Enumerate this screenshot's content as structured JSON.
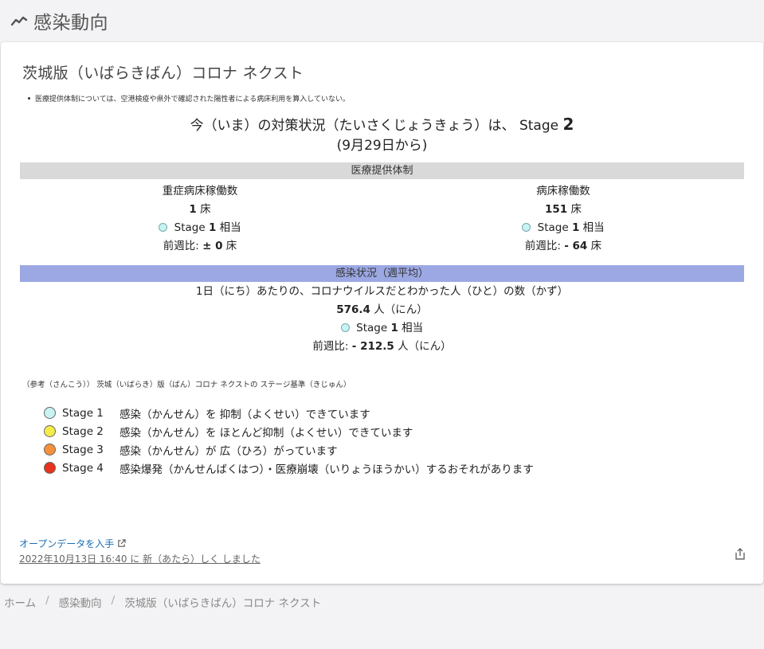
{
  "page": {
    "title": "感染動向"
  },
  "card": {
    "title": "茨城版（いばらきばん）コロナ ネクスト",
    "note": "医療提供体制については、空港検疫や県外で確認された陽性者による病床利用を算入していない。",
    "status": {
      "prefix": "今（いま）の対策状況（たいさくじょうきょう）は、 Stage",
      "stage": "2",
      "since": "(9月29日から)"
    },
    "medical": {
      "band_label": "医療提供体制",
      "left": {
        "label": "重症病床稼働数",
        "value": "1",
        "unit": "床",
        "stage_prefix": "Stage",
        "stage_num": "1",
        "stage_suffix": "相当",
        "wow_label": "前週比:",
        "wow_value": "± 0",
        "wow_unit": "床"
      },
      "right": {
        "label": "病床稼働数",
        "value": "151",
        "unit": "床",
        "stage_prefix": "Stage",
        "stage_num": "1",
        "stage_suffix": "相当",
        "wow_label": "前週比:",
        "wow_value": "- 64",
        "wow_unit": "床"
      }
    },
    "infection": {
      "band_label": "感染状況（週平均）",
      "label": "1日（にち）あたりの、コロナウイルスだとわかった人（ひと）の数（かず）",
      "value": "576.4",
      "unit": "人（にん）",
      "stage_prefix": "Stage",
      "stage_num": "1",
      "stage_suffix": "相当",
      "wow_label": "前週比:",
      "wow_value": "- 212.5",
      "wow_unit": "人（にん）"
    },
    "reference": "（参考（さんこう））  茨城（いばらき）版（ばん）コロナ ネクストの ステージ基準（きじゅん）",
    "legend": [
      {
        "stage": "Stage 1",
        "text": "感染（かんせん）を 抑制（よくせい）できています",
        "color": "#c8f3f5"
      },
      {
        "stage": "Stage 2",
        "text": "感染（かんせん）を ほとんど抑制（よくせい）できています",
        "color": "#f5ec4a"
      },
      {
        "stage": "Stage 3",
        "text": "感染（かんせん）が 広（ひろ）がっています",
        "color": "#f5913a"
      },
      {
        "stage": "Stage 4",
        "text": "感染爆発（かんせんばくはつ）・医療崩壊（いりょうほうかい）するおそれがあります",
        "color": "#e6321e"
      }
    ],
    "stage1_color": "#c8f3f5",
    "footer": {
      "open_data": "オープンデータを入手",
      "updated": "2022年10月13日 16:40 に 新（あたら）しく しました"
    }
  },
  "breadcrumb": [
    "ホーム",
    "感染動向",
    "茨城版（いばらきばん）コロナ ネクスト"
  ]
}
